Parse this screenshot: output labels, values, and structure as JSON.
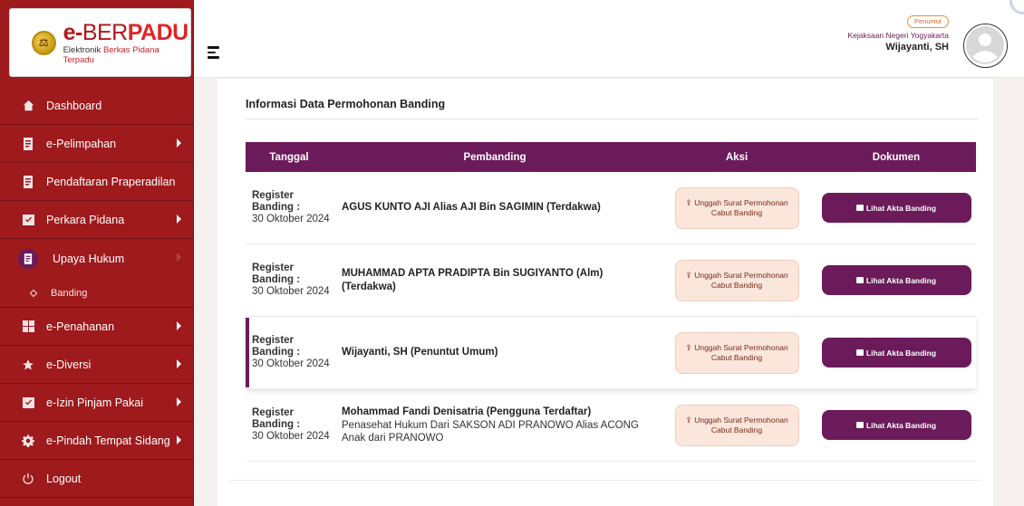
{
  "logo": {
    "title_prefix": "e-",
    "title_mid": "BER",
    "title_suffix": "PADU",
    "subtitle_pre": "Elektronik ",
    "subtitle_red": "Berkas Pidana Terpadu"
  },
  "sidebar": {
    "items": [
      {
        "label": "Dashboard",
        "icon": "home-icon"
      },
      {
        "label": "e-Pelimpahan",
        "icon": "document-icon"
      },
      {
        "label": "Pendaftaran Praperadilan",
        "icon": "document-icon"
      },
      {
        "label": "Perkara Pidana",
        "icon": "checklist-icon"
      },
      {
        "label": "Upaya Hukum",
        "icon": "document-icon"
      },
      {
        "label": "Banding",
        "icon": "diamond-icon"
      },
      {
        "label": "e-Penahanan",
        "icon": "grid-icon"
      },
      {
        "label": "e-Diversi",
        "icon": "star-icon"
      },
      {
        "label": "e-Izin Pinjam Pakai",
        "icon": "checklist-icon"
      },
      {
        "label": "e-Pindah Tempat Sidang",
        "icon": "gear-icon"
      },
      {
        "label": "Logout",
        "icon": "power-icon"
      }
    ]
  },
  "header": {
    "role_badge": "Penuntut",
    "organization": "Kejaksaan Negeri Yogyakarta",
    "user_name": "Wijayanti, SH"
  },
  "main": {
    "section_title": "Informasi Data Permohonan Banding",
    "columns": [
      "Tanggal",
      "Pembanding",
      "Aksi",
      "Dokumen"
    ],
    "rows": [
      {
        "date_label": "Register Banding :",
        "date_value": "30 Oktober 2024",
        "name": "AGUS KUNTO AJI Alias AJI Bin SAGIMIN (Terdakwa)",
        "desc": "",
        "aksi_label": "Unggah Surat Permohonan Cabut Banding",
        "dokumen_label": "Lihat Akta Banding"
      },
      {
        "date_label": "Register Banding :",
        "date_value": "30 Oktober 2024",
        "name": "MUHAMMAD APTA PRADIPTA Bin SUGIYANTO (Alm) (Terdakwa)",
        "desc": "",
        "aksi_label": "Unggah Surat Permohonan Cabut Banding",
        "dokumen_label": "Lihat Akta Banding"
      },
      {
        "date_label": "Register Banding :",
        "date_value": "30 Oktober 2024",
        "name": "Wijayanti, SH (Penuntut Umum)",
        "desc": "",
        "aksi_label": "Unggah Surat Permohonan Cabut Banding",
        "dokumen_label": "Lihat Akta Banding"
      },
      {
        "date_label": "Register Banding :",
        "date_value": "30 Oktober 2024",
        "name": "Mohammad Fandi Denisatria (Pengguna Terdaftar)",
        "desc": "Penasehat Hukum Dari SAKSON ADI PRANOWO Alias ACONG Anak dari PRANOWO",
        "aksi_label": "Unggah Surat Permohonan Cabut Banding",
        "dokumen_label": "Lihat Akta Banding"
      }
    ]
  },
  "colors": {
    "sidebar_bg": "#9e1a1c",
    "accent_purple": "#6b1b59",
    "badge_orange": "#e8903a",
    "button_peach": "#fbe6dc"
  }
}
